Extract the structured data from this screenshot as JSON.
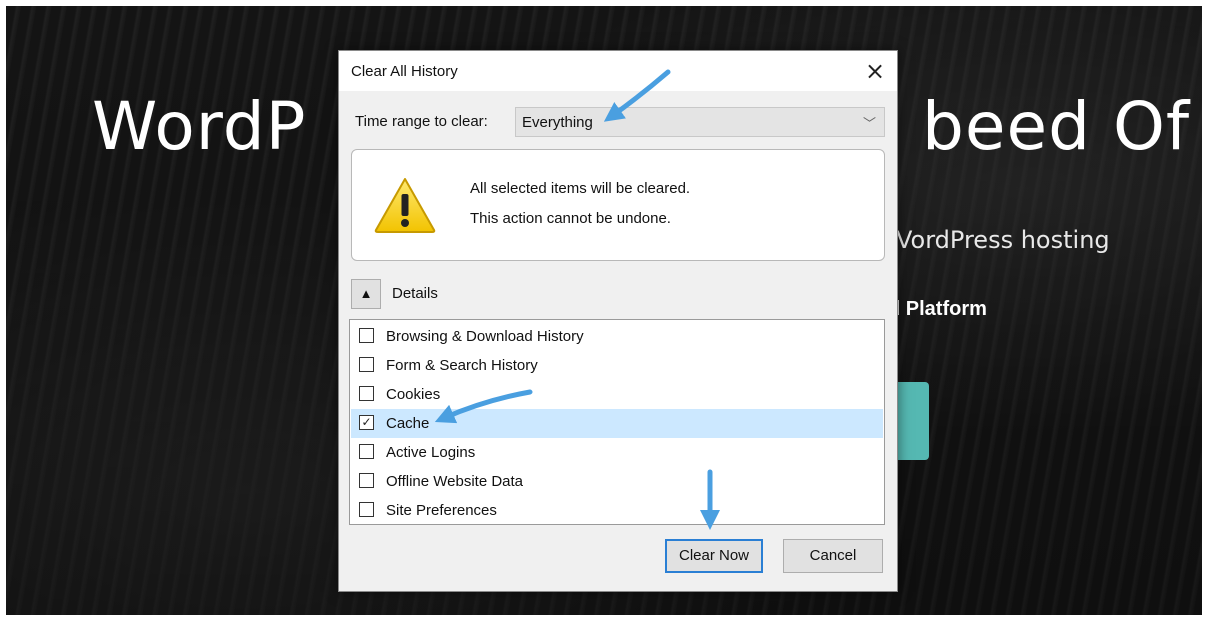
{
  "background": {
    "title_left": "WordP",
    "title_right": "beed Of",
    "subtitle": "VordPress hosting",
    "platform": "d Platform"
  },
  "dialog": {
    "title": "Clear All History",
    "close_symbol": "×",
    "time_range": {
      "label": "Time range to clear:",
      "value": "Everything"
    },
    "warning": {
      "line1": "All selected items will be cleared.",
      "line2": "This action cannot be undone."
    },
    "details": {
      "toggle_symbol": "▲",
      "label": "Details"
    },
    "items": [
      {
        "label": "Browsing & Download History",
        "checked": false
      },
      {
        "label": "Form & Search History",
        "checked": false
      },
      {
        "label": "Cookies",
        "checked": false
      },
      {
        "label": "Cache",
        "checked": true
      },
      {
        "label": "Active Logins",
        "checked": false
      },
      {
        "label": "Offline Website Data",
        "checked": false
      },
      {
        "label": "Site Preferences",
        "checked": false
      }
    ],
    "buttons": {
      "clear_now": "Clear Now",
      "cancel": "Cancel"
    }
  },
  "colors": {
    "arrow": "#4a9fe0",
    "selected_row": "#cce8ff",
    "cta": "#55b8b2"
  }
}
